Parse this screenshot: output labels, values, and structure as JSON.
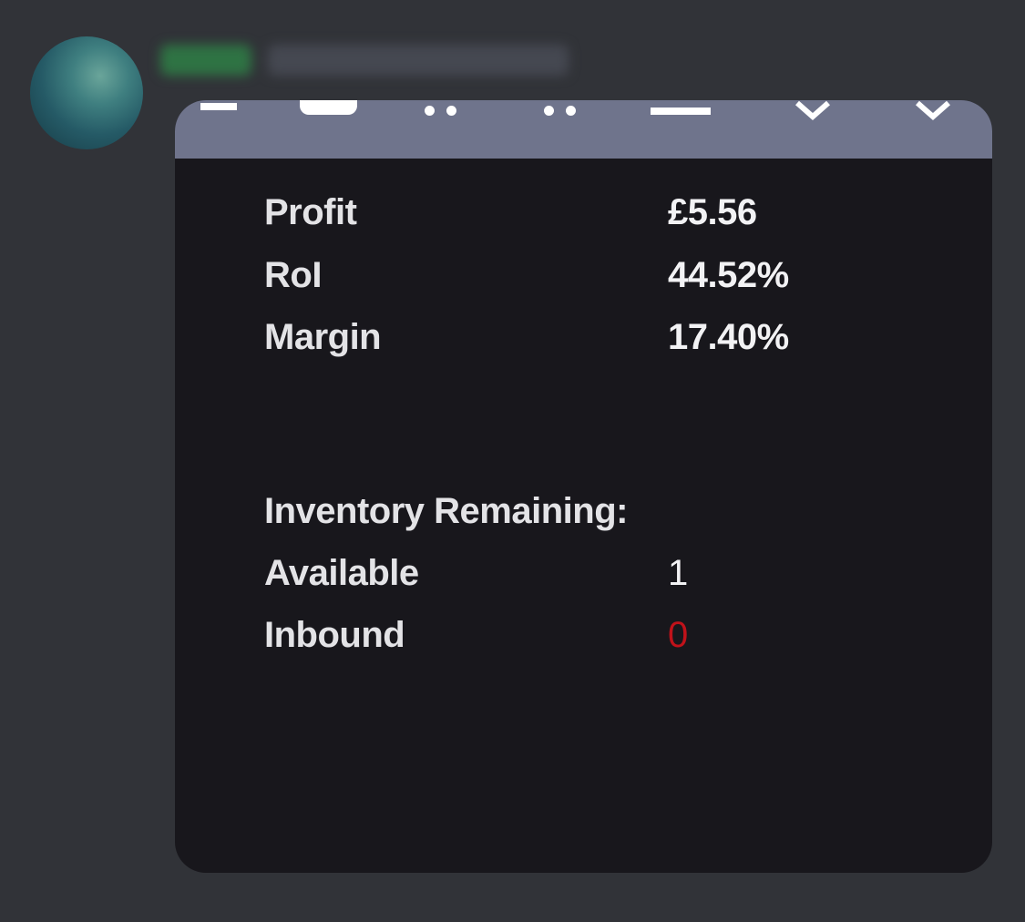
{
  "message": {
    "author_blurred": "",
    "timestamp_blurred": ""
  },
  "toolbar": {
    "icons": [
      "dash-icon",
      "tray-icon",
      "drag-dots-icon",
      "drag-dots-icon",
      "minimize-icon",
      "chevron-down-icon",
      "chevron-down-icon"
    ]
  },
  "stats": {
    "profit": {
      "label": "Profit",
      "value": "£5.56"
    },
    "roi": {
      "label": "RoI",
      "value": "44.52%"
    },
    "margin": {
      "label": "Margin",
      "value": "17.40%"
    }
  },
  "inventory": {
    "heading": "Inventory Remaining:",
    "available": {
      "label": "Available",
      "value": "1"
    },
    "inbound": {
      "label": "Inbound",
      "value": "0",
      "value_color": "#c0121a"
    }
  }
}
